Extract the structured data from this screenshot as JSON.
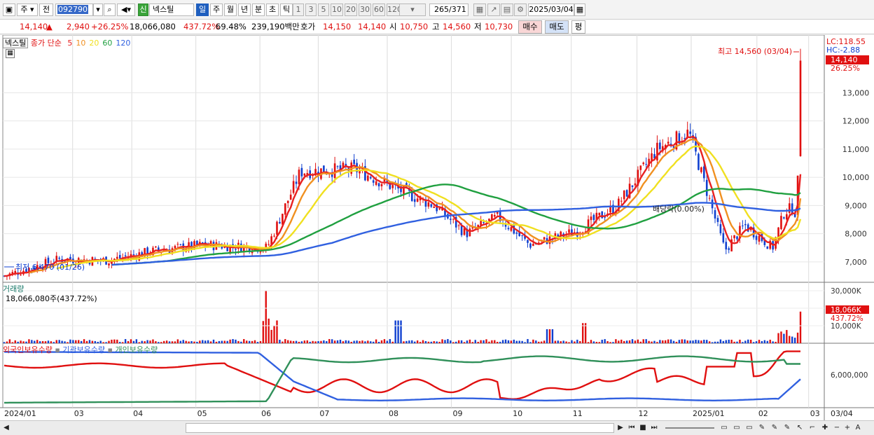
{
  "toolbar": {
    "period_type": "주",
    "prev_label": "전",
    "stock_code": "092790",
    "market_badge": "신",
    "stock_name": "넥스틸",
    "period_tabs": [
      "일",
      "주",
      "월",
      "년",
      "분",
      "초",
      "틱"
    ],
    "active_tab": "일",
    "intervals": [
      "1",
      "3",
      "5",
      "10",
      "20",
      "30",
      "60",
      "120"
    ],
    "count_display": "265",
    "count_total": "/371",
    "date": "2025/03/04"
  },
  "quote": {
    "price": "14,140",
    "change_arrow": "▲",
    "change": "2,940",
    "change_pct": "+26.25%",
    "volume": "18,066,080",
    "volume_ratio": "437.72%",
    "turnover": "69.48%",
    "amount": "239,190백만",
    "bid_label": "호가",
    "bid1": "14,150",
    "bid2": "14,140",
    "open_label": "시",
    "open": "10,750",
    "high_label": "고",
    "high": "14,560",
    "low_label": "저",
    "low": "10,730",
    "buy_label": "매수",
    "sell_label": "매도",
    "avg_label": "평"
  },
  "price_pane": {
    "tag_name": "넥스틸",
    "ma_label": "종가 단순",
    "ma_periods": [
      "5",
      "10",
      "20",
      "60",
      "120"
    ],
    "ma_colors": [
      "#e82020",
      "#f09020",
      "#f0e020",
      "#20a040",
      "#3060e0"
    ],
    "lc_label": "LC:118.55",
    "hc_label": "HC:-2.88",
    "current_price": "14,140",
    "current_pct": "26.25%",
    "max_annotation": "최고 14,560 (03/04)",
    "min_annotation": "최저 6,470 (01/26)",
    "dividend_label": "배당락(0.00%)",
    "y_ticks": [
      "13,000",
      "12,000",
      "11,000",
      "10,000",
      "9,000",
      "8,000",
      "7,000"
    ]
  },
  "volume_pane": {
    "title": "거래량",
    "value_label": "18,066,080주(437.72%)",
    "y_ticks": [
      "30,000K",
      "20,000K",
      "10,000K"
    ],
    "current_value": "18,066K",
    "current_pct": "437.72%"
  },
  "holdings_pane": {
    "series_labels": [
      "외국인보유수량",
      "기관보유수량",
      "개인보유수량"
    ],
    "series_colors": [
      "#e01010",
      "#3060e0",
      "#30905a"
    ],
    "y_tick": "6,000,000"
  },
  "x_axis": {
    "labels": [
      "2024/01",
      "03",
      "04",
      "05",
      "06",
      "07",
      "08",
      "09",
      "10",
      "11",
      "12",
      "2025/01",
      "02",
      "03"
    ],
    "right_label": "03/04"
  },
  "chart_data": [
    {
      "type": "candlestick",
      "title": "넥스틸",
      "y_range": [
        6470,
        14560
      ],
      "ohlc_latest": {
        "date": "2025/03/04",
        "open": 10750,
        "high": 14560,
        "low": 10730,
        "close": 14140
      },
      "highest": {
        "value": 14560,
        "date": "03/04"
      },
      "lowest": {
        "value": 6470,
        "date": "01/26"
      },
      "close_path": [
        [
          "2024/01",
          6500
        ],
        [
          "2024/02",
          7100
        ],
        [
          "2024/03",
          7050
        ],
        [
          "2024/04",
          7400
        ],
        [
          "2024/05",
          7600
        ],
        [
          "2024/06-early",
          7500
        ],
        [
          "2024/06-late",
          10200
        ],
        [
          "2024/07",
          10300
        ],
        [
          "2024/07-late",
          9500
        ],
        [
          "2024/08",
          9000
        ],
        [
          "2024/08-late",
          8000
        ],
        [
          "2024/09",
          8600
        ],
        [
          "2024/09-late",
          7600
        ],
        [
          "2024/10",
          8100
        ],
        [
          "2024/11",
          9000
        ],
        [
          "2024/11-mid",
          11000
        ],
        [
          "2024/11-late",
          11600
        ],
        [
          "2024/12",
          7400
        ],
        [
          "2024/12-late",
          8300
        ],
        [
          "2025/01",
          7500
        ],
        [
          "2025/01-late",
          8800
        ],
        [
          "2025/02",
          8900
        ],
        [
          "2025/02-late",
          8700
        ],
        [
          "2025/03",
          10900
        ],
        [
          "2025/03/04",
          14140
        ]
      ]
    },
    {
      "type": "bar",
      "title": "거래량",
      "unit": "K",
      "latest": 18066,
      "peak": 30000
    }
  ]
}
